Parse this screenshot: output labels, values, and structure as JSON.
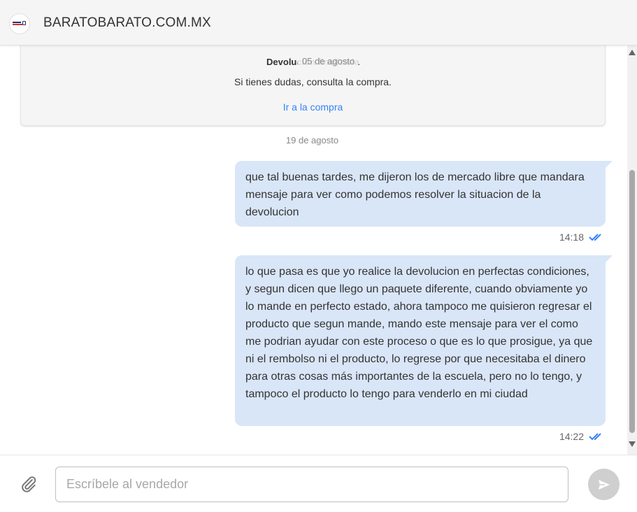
{
  "header": {
    "store_name": "BARATOBARATO.COM.MX",
    "logo_icon": "store-logo"
  },
  "status_card": {
    "title": "Devolución finalizada",
    "date_badge": "05 de agosto",
    "message": "Si tienes dudas, consulta la compra.",
    "link": "Ir a la compra"
  },
  "day_separator": "19 de agosto",
  "messages": [
    {
      "text": "que tal buenas tardes, me dijeron los de mercado libre que mandara mensaje para ver como podemos resolver la situacion de la devolucion",
      "time": "14:18",
      "status_icon": "double-check-icon"
    },
    {
      "text": "lo que pasa es que yo realice la devolucion en perfectas condiciones, y segun dicen que llego un paquete diferente, cuando obviamente yo lo mande en perfecto estado, ahora tampoco me quisieron regresar el producto que segun mande, mando este mensaje para ver el como me podrian ayudar con este proceso o que es lo que prosigue, ya que ni el rembolso ni el producto, lo regrese por que necesitaba el dinero para otras cosas más importantes de la escuela, pero no lo tengo, y tampoco el producto lo tengo para venderlo en mi ciudad",
      "time": "14:22",
      "status_icon": "double-check-icon"
    }
  ],
  "composer": {
    "placeholder": "Escríbele al vendedor",
    "value": "",
    "attach_icon": "paperclip-icon",
    "send_icon": "send-icon"
  },
  "colors": {
    "bubble": "#d9e6f8",
    "link": "#3483fa",
    "check": "#3483fa",
    "send_disabled": "#cfcfcf"
  }
}
